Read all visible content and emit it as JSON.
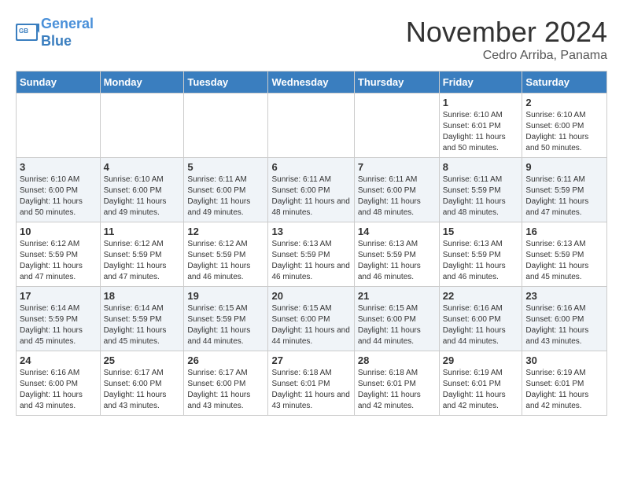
{
  "header": {
    "logo_line1": "General",
    "logo_line2": "Blue",
    "month_title": "November 2024",
    "location": "Cedro Arriba, Panama"
  },
  "weekdays": [
    "Sunday",
    "Monday",
    "Tuesday",
    "Wednesday",
    "Thursday",
    "Friday",
    "Saturday"
  ],
  "weeks": [
    [
      {
        "day": "",
        "info": ""
      },
      {
        "day": "",
        "info": ""
      },
      {
        "day": "",
        "info": ""
      },
      {
        "day": "",
        "info": ""
      },
      {
        "day": "",
        "info": ""
      },
      {
        "day": "1",
        "info": "Sunrise: 6:10 AM\nSunset: 6:01 PM\nDaylight: 11 hours and 50 minutes."
      },
      {
        "day": "2",
        "info": "Sunrise: 6:10 AM\nSunset: 6:00 PM\nDaylight: 11 hours and 50 minutes."
      }
    ],
    [
      {
        "day": "3",
        "info": "Sunrise: 6:10 AM\nSunset: 6:00 PM\nDaylight: 11 hours and 50 minutes."
      },
      {
        "day": "4",
        "info": "Sunrise: 6:10 AM\nSunset: 6:00 PM\nDaylight: 11 hours and 49 minutes."
      },
      {
        "day": "5",
        "info": "Sunrise: 6:11 AM\nSunset: 6:00 PM\nDaylight: 11 hours and 49 minutes."
      },
      {
        "day": "6",
        "info": "Sunrise: 6:11 AM\nSunset: 6:00 PM\nDaylight: 11 hours and 48 minutes."
      },
      {
        "day": "7",
        "info": "Sunrise: 6:11 AM\nSunset: 6:00 PM\nDaylight: 11 hours and 48 minutes."
      },
      {
        "day": "8",
        "info": "Sunrise: 6:11 AM\nSunset: 5:59 PM\nDaylight: 11 hours and 48 minutes."
      },
      {
        "day": "9",
        "info": "Sunrise: 6:11 AM\nSunset: 5:59 PM\nDaylight: 11 hours and 47 minutes."
      }
    ],
    [
      {
        "day": "10",
        "info": "Sunrise: 6:12 AM\nSunset: 5:59 PM\nDaylight: 11 hours and 47 minutes."
      },
      {
        "day": "11",
        "info": "Sunrise: 6:12 AM\nSunset: 5:59 PM\nDaylight: 11 hours and 47 minutes."
      },
      {
        "day": "12",
        "info": "Sunrise: 6:12 AM\nSunset: 5:59 PM\nDaylight: 11 hours and 46 minutes."
      },
      {
        "day": "13",
        "info": "Sunrise: 6:13 AM\nSunset: 5:59 PM\nDaylight: 11 hours and 46 minutes."
      },
      {
        "day": "14",
        "info": "Sunrise: 6:13 AM\nSunset: 5:59 PM\nDaylight: 11 hours and 46 minutes."
      },
      {
        "day": "15",
        "info": "Sunrise: 6:13 AM\nSunset: 5:59 PM\nDaylight: 11 hours and 46 minutes."
      },
      {
        "day": "16",
        "info": "Sunrise: 6:13 AM\nSunset: 5:59 PM\nDaylight: 11 hours and 45 minutes."
      }
    ],
    [
      {
        "day": "17",
        "info": "Sunrise: 6:14 AM\nSunset: 5:59 PM\nDaylight: 11 hours and 45 minutes."
      },
      {
        "day": "18",
        "info": "Sunrise: 6:14 AM\nSunset: 5:59 PM\nDaylight: 11 hours and 45 minutes."
      },
      {
        "day": "19",
        "info": "Sunrise: 6:15 AM\nSunset: 5:59 PM\nDaylight: 11 hours and 44 minutes."
      },
      {
        "day": "20",
        "info": "Sunrise: 6:15 AM\nSunset: 6:00 PM\nDaylight: 11 hours and 44 minutes."
      },
      {
        "day": "21",
        "info": "Sunrise: 6:15 AM\nSunset: 6:00 PM\nDaylight: 11 hours and 44 minutes."
      },
      {
        "day": "22",
        "info": "Sunrise: 6:16 AM\nSunset: 6:00 PM\nDaylight: 11 hours and 44 minutes."
      },
      {
        "day": "23",
        "info": "Sunrise: 6:16 AM\nSunset: 6:00 PM\nDaylight: 11 hours and 43 minutes."
      }
    ],
    [
      {
        "day": "24",
        "info": "Sunrise: 6:16 AM\nSunset: 6:00 PM\nDaylight: 11 hours and 43 minutes."
      },
      {
        "day": "25",
        "info": "Sunrise: 6:17 AM\nSunset: 6:00 PM\nDaylight: 11 hours and 43 minutes."
      },
      {
        "day": "26",
        "info": "Sunrise: 6:17 AM\nSunset: 6:00 PM\nDaylight: 11 hours and 43 minutes."
      },
      {
        "day": "27",
        "info": "Sunrise: 6:18 AM\nSunset: 6:01 PM\nDaylight: 11 hours and 43 minutes."
      },
      {
        "day": "28",
        "info": "Sunrise: 6:18 AM\nSunset: 6:01 PM\nDaylight: 11 hours and 42 minutes."
      },
      {
        "day": "29",
        "info": "Sunrise: 6:19 AM\nSunset: 6:01 PM\nDaylight: 11 hours and 42 minutes."
      },
      {
        "day": "30",
        "info": "Sunrise: 6:19 AM\nSunset: 6:01 PM\nDaylight: 11 hours and 42 minutes."
      }
    ]
  ]
}
